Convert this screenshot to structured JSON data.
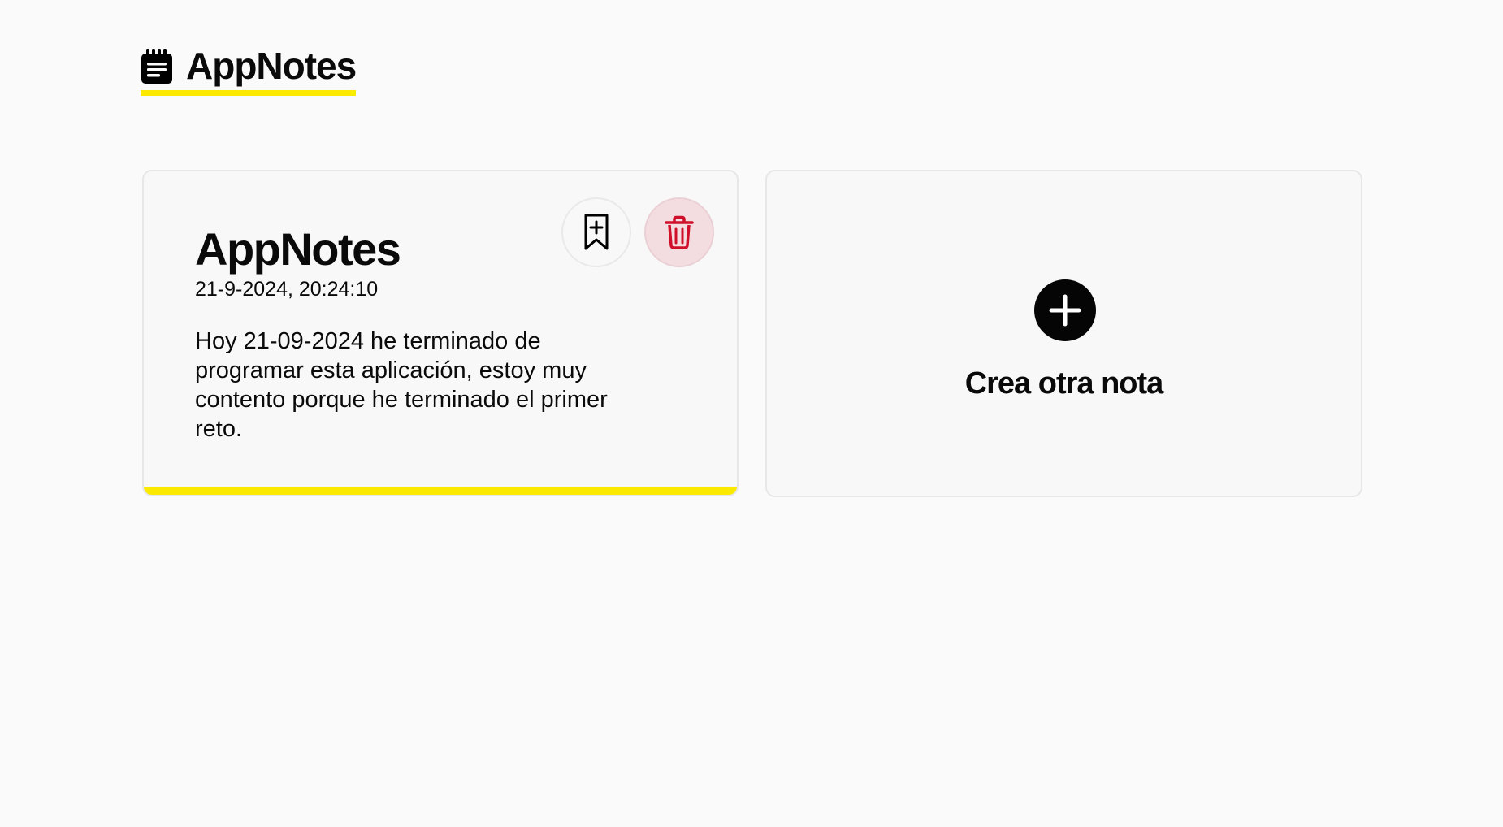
{
  "header": {
    "app_title": "AppNotes",
    "icon": "notepad-icon",
    "accent_color": "#fbe900"
  },
  "notes": [
    {
      "title": "AppNotes",
      "date": "21-9-2024, 20:24:10",
      "body": "Hoy 21-09-2024 he terminado de programar esta aplicación, estoy muy contento porque he terminado el primer reto.",
      "bookmark_icon": "bookmark-plus-icon",
      "delete_icon": "trash-icon",
      "delete_color": "#d0102a"
    }
  ],
  "create_card": {
    "label": "Crea otra nota",
    "icon": "plus-circle-icon"
  }
}
